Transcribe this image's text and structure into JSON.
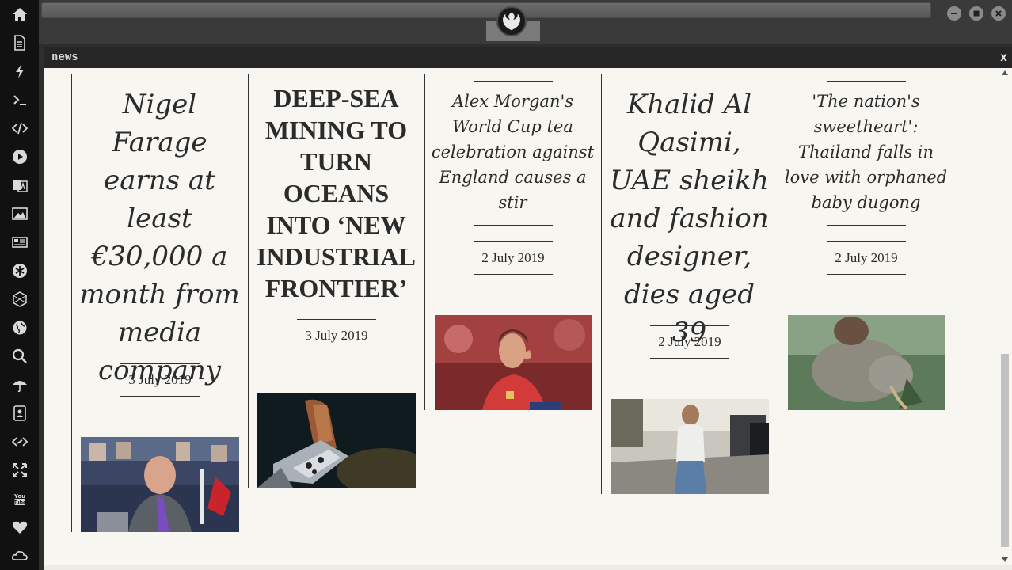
{
  "dock": {
    "icons": [
      "home-icon",
      "document-icon",
      "bolt-icon",
      "terminal-icon",
      "code-icon",
      "play-icon",
      "translate-icon",
      "image-icon",
      "newspaper-icon",
      "asterisk-icon",
      "cube-icon",
      "globe-icon",
      "search-icon",
      "umbrella-icon",
      "contact-card-icon",
      "link-code-icon",
      "expand-icon",
      "youtube-icon",
      "heart-icon",
      "cloud-icon"
    ]
  },
  "window_controls": [
    "minimize-icon",
    "maximize-icon",
    "close-icon"
  ],
  "news_window": {
    "title": "news",
    "close_label": "x"
  },
  "articles": [
    {
      "headline": "Nigel Farage earns at least €30,000 a month from media company",
      "date": "3 July 2019",
      "image": "photo of man laughing in parliament chamber"
    },
    {
      "headline": "DEEP-SEA MINING TO TURN OCEANS INTO ‘NEW INDUSTRIAL FRONTIER’",
      "date": "3 July 2019",
      "image": "photo of robotic claw on seabed rock"
    },
    {
      "headline": "Alex Morgan's World Cup tea celebration against England causes a stir",
      "date": "2 July 2019",
      "image": "photo of footballer in red kit"
    },
    {
      "headline": "Khalid Al Qasimi, UAE sheikh and fashion designer, dies aged 39",
      "date": "2 July 2019",
      "image": "photo of man walking in white shirt"
    },
    {
      "headline": "'The nation's sweetheart': Thailand falls in love with orphaned baby dugong",
      "date": "2 July 2019",
      "image": "photo of baby dugong underwater"
    }
  ],
  "colors": {
    "dock_bg": "#111111",
    "page_bg": "#f7f6f1",
    "ink": "#2b2b2b"
  }
}
